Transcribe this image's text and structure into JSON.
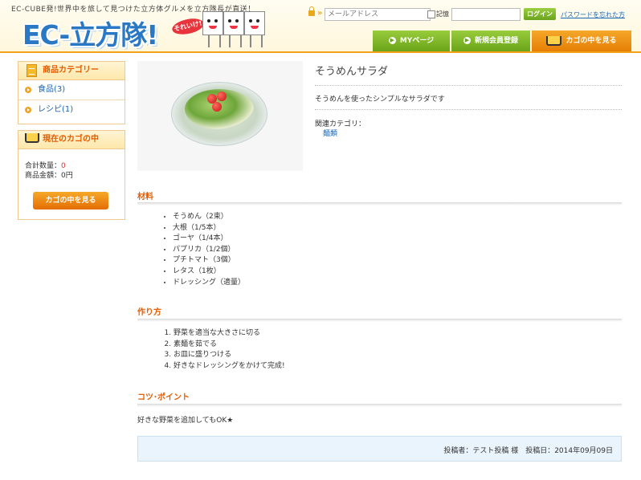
{
  "header": {
    "tagline": "EC-CUBE発!世界中を旅して見つけた立方体グルメを立方隊長が直送！",
    "logo_text": "EC-立方隊!",
    "logo_badge": "それいけ!",
    "login": {
      "email_placeholder": "メールアドレス",
      "remember_label": "記憶",
      "login_button": "ログイン",
      "forgot_link": "パスワードを忘れた方"
    },
    "nav": {
      "mypage": "MYページ",
      "register": "新規会員登録",
      "cart": "カゴの中を見る"
    }
  },
  "sidebar": {
    "category_title": "商品カテゴリー",
    "categories": [
      {
        "label": "食品(3)"
      },
      {
        "label": "レシピ(1)"
      }
    ],
    "cart": {
      "title": "現在のカゴの中",
      "total_qty_label": "合計数量：",
      "total_qty_value": "0",
      "total_price_label": "商品金額：",
      "total_price_value": "0円",
      "button": "カゴの中を見る"
    }
  },
  "recipe": {
    "title": "そうめんサラダ",
    "description": "そうめんを使ったシンプルなサラダです",
    "related_label": "関連カテゴリ：",
    "related_category": "麺類",
    "ingredients_title": "材料",
    "ingredients": [
      "そうめん（2束）",
      "大根（1/5本）",
      "ゴーヤ（1/4本）",
      "パプリカ（1/2個）",
      "プチトマト（3個）",
      "レタス（1枚）",
      "ドレッシング（適量）"
    ],
    "steps_title": "作り方",
    "steps": [
      "野菜を適当な大きさに切る",
      "素麺を茹でる",
      "お皿に盛りつける",
      "好きなドレッシングをかけて完成!"
    ],
    "tip_title": "コツ･ポイント",
    "tip_text": "好きな野菜を追加してもOK★",
    "meta": "投稿者：テスト投稿 様　投稿日：2014年09月09日"
  },
  "colors": {
    "accent_orange": "#e45c00",
    "nav_green": "#6aa419",
    "nav_orange": "#e57e05",
    "link_blue": "#1a66b3"
  }
}
